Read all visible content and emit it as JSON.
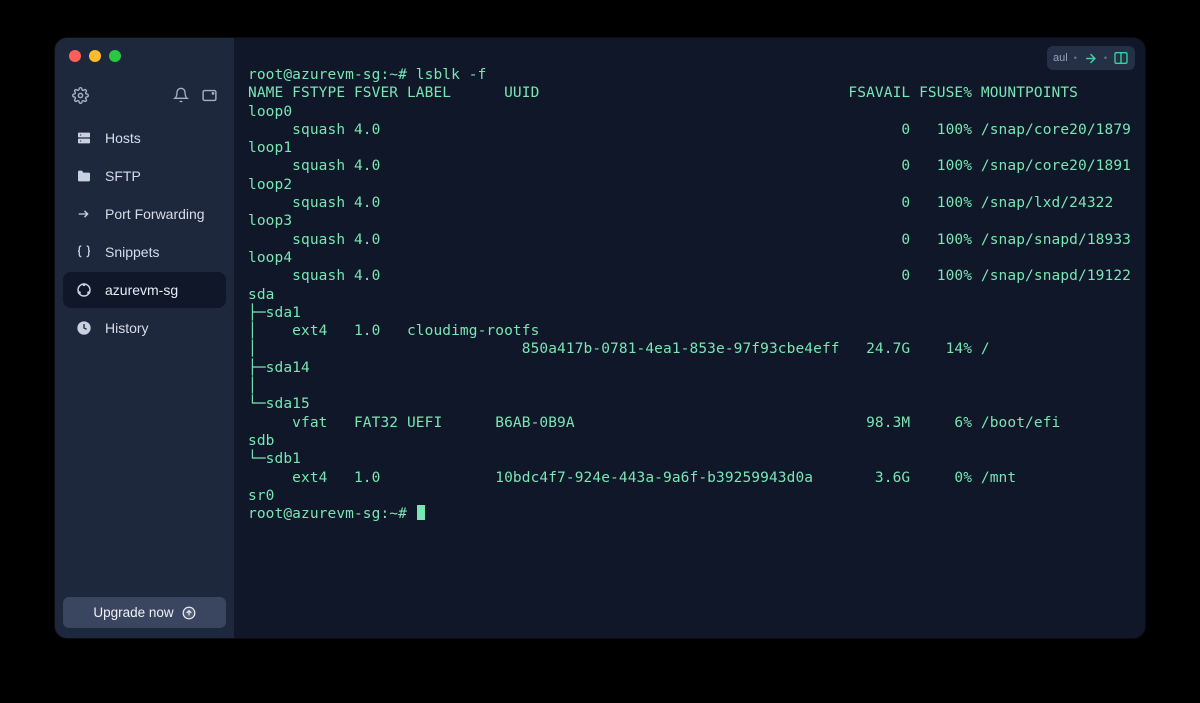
{
  "sidebar": {
    "nav": [
      {
        "icon": "hosts",
        "label": "Hosts",
        "active": false
      },
      {
        "icon": "folder",
        "label": "SFTP",
        "active": false
      },
      {
        "icon": "portfwd",
        "label": "Port Forwarding",
        "active": false
      },
      {
        "icon": "braces",
        "label": "Snippets",
        "active": false
      },
      {
        "icon": "ubuntu",
        "label": "azurevm-sg",
        "active": true
      },
      {
        "icon": "clock",
        "label": "History",
        "active": false
      }
    ],
    "upgrade_label": "Upgrade now"
  },
  "titlebar": {
    "badge": "aul"
  },
  "terminal": {
    "prompt_user_host": "root@azurevm-sg",
    "prompt_path": "~",
    "command": "lsblk -f",
    "header": {
      "name": "NAME",
      "fstype": "FSTYPE",
      "fsver": "FSVER",
      "label": "LABEL",
      "uuid": "UUID",
      "fsavail": "FSAVAIL",
      "fsuse": "FSUSE%",
      "mountpoints": "MOUNTPOINTS"
    },
    "rows": [
      {
        "tree": "loop0"
      },
      {
        "tree": "     squash 4.0",
        "fsavail": "0",
        "fsuse": "100%",
        "mount": "/snap/core20/1879"
      },
      {
        "tree": "loop1"
      },
      {
        "tree": "     squash 4.0",
        "fsavail": "0",
        "fsuse": "100%",
        "mount": "/snap/core20/1891"
      },
      {
        "tree": "loop2"
      },
      {
        "tree": "     squash 4.0",
        "fsavail": "0",
        "fsuse": "100%",
        "mount": "/snap/lxd/24322"
      },
      {
        "tree": "loop3"
      },
      {
        "tree": "     squash 4.0",
        "fsavail": "0",
        "fsuse": "100%",
        "mount": "/snap/snapd/18933"
      },
      {
        "tree": "loop4"
      },
      {
        "tree": "     squash 4.0",
        "fsavail": "0",
        "fsuse": "100%",
        "mount": "/snap/snapd/19122"
      },
      {
        "tree": "sda"
      },
      {
        "tree": "├─sda1"
      },
      {
        "tree": "│    ext4   1.0   cloudimg-rootfs"
      },
      {
        "tree": "│                              850a417b-0781-4ea1-853e-97f93cbe4eff",
        "fsavail": "24.7G",
        "fsuse": "14%",
        "mount": "/"
      },
      {
        "tree": "├─sda14"
      },
      {
        "tree": "│"
      },
      {
        "tree": "└─sda15"
      },
      {
        "tree": "     vfat   FAT32 UEFI      B6AB-0B9A",
        "fsavail": "98.3M",
        "fsuse": "6%",
        "mount": "/boot/efi"
      },
      {
        "tree": "sdb"
      },
      {
        "tree": "└─sdb1"
      },
      {
        "tree": "     ext4   1.0             10bdc4f7-924e-443a-9a6f-b39259943d0a",
        "fsavail": "3.6G",
        "fsuse": "0%",
        "mount": "/mnt"
      },
      {
        "tree": "sr0"
      }
    ],
    "prompt2": "root@azurevm-sg:~# "
  }
}
